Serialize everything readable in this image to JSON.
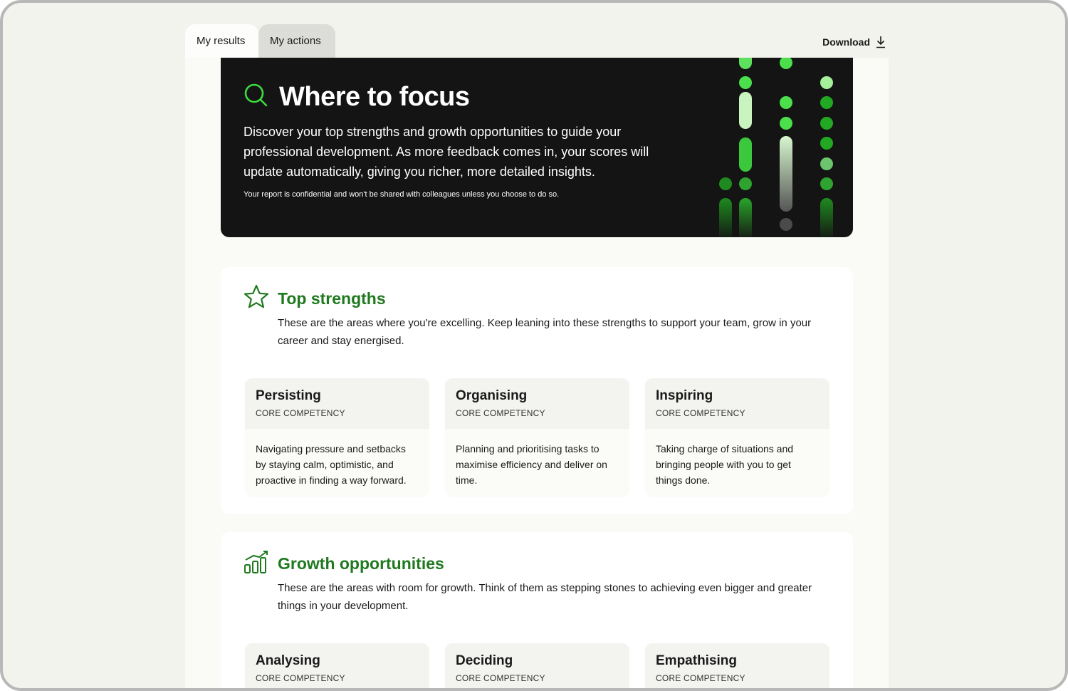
{
  "tabs": [
    {
      "label": "My results",
      "active": true
    },
    {
      "label": "My actions",
      "active": false
    }
  ],
  "download": {
    "label": "Download",
    "icon": "download-icon"
  },
  "hero": {
    "icon": "search-icon",
    "title": "Where to focus",
    "description": "Discover your top strengths and growth opportunities to guide your professional development. As more feedback comes in, your scores will update automatically, giving you richer, more detailed insights.",
    "note": "Your report is confidential and won't be shared with colleagues unless you choose to do so."
  },
  "strengths": {
    "icon": "star-icon",
    "title": "Top strengths",
    "description": "These are the areas where you're excelling. Keep leaning into these strengths to support your team, grow in your career and stay energised.",
    "cards": [
      {
        "title": "Persisting",
        "subtitle": "CORE COMPETENCY",
        "body": "Navigating pressure and setbacks by staying calm, optimistic, and proactive in finding a way forward."
      },
      {
        "title": "Organising",
        "subtitle": "CORE COMPETENCY",
        "body": "Planning and prioritising tasks to maximise efficiency and deliver on time."
      },
      {
        "title": "Inspiring",
        "subtitle": "CORE COMPETENCY",
        "body": "Taking charge of situations and bringing people with you to get things done."
      }
    ]
  },
  "growth": {
    "icon": "growth-chart-icon",
    "title": "Growth opportunities",
    "description": "These are the areas with room for growth. Think of them as stepping stones to achieving even bigger and greater things in your development.",
    "cards": [
      {
        "title": "Analysing",
        "subtitle": "CORE COMPETENCY"
      },
      {
        "title": "Deciding",
        "subtitle": "CORE COMPETENCY"
      },
      {
        "title": "Empathising",
        "subtitle": "CORE COMPETENCY"
      }
    ]
  },
  "colors": {
    "accent_green": "#1f7a1f",
    "bright_green": "#3ddc3d",
    "hero_background": "#141414",
    "page_background": "#f3f3ee"
  }
}
